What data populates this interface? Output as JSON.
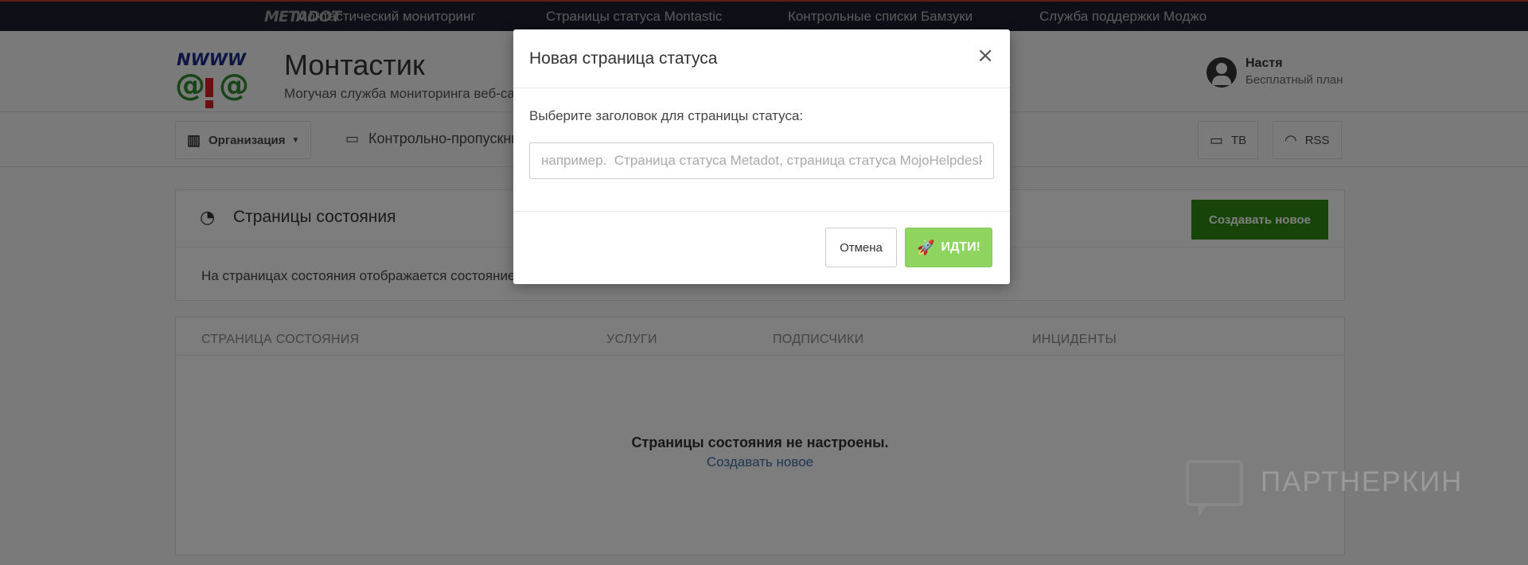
{
  "topbar": {
    "logo": "METADOT",
    "links": [
      "Монтастический мониторинг",
      "Страницы статуса Montastic",
      "Контрольные списки Бамзуки",
      "Служба поддержки Моджо"
    ]
  },
  "header": {
    "title": "Монтастик",
    "subtitle": "Могучая служба мониторинга веб-сайтов",
    "user_name": "Настя",
    "user_plan": "Бесплатный план"
  },
  "nav": {
    "org_label": "Организация",
    "checkpoints_label": "Контрольно-пропускные",
    "tv_label": "ТВ",
    "rss_label": "RSS"
  },
  "status_panel": {
    "title": "Страницы состояния",
    "create_label": "Создавать новое",
    "description": "На страницах состояния отображается состояние ваших контрольно-пропускных пунктов."
  },
  "table": {
    "columns": [
      "СТРАНИЦА СОСТОЯНИЯ",
      "УСЛУГИ",
      "ПОДПИСЧИКИ",
      "ИНЦИДЕНТЫ"
    ],
    "empty_title": "Страницы состояния не настроены.",
    "empty_link": "Создавать новое"
  },
  "watermark": {
    "text": "ПАРТНЕРКИН"
  },
  "modal": {
    "title": "Новая страница статуса",
    "close": "×",
    "label": "Выберите заголовок для страницы статуса:",
    "input_value": "",
    "input_placeholder": "например.  Страница статуса Metadot, страница статуса MojoHelpdesk",
    "cancel_label": "Отмена",
    "go_label": "ИДТИ!"
  }
}
